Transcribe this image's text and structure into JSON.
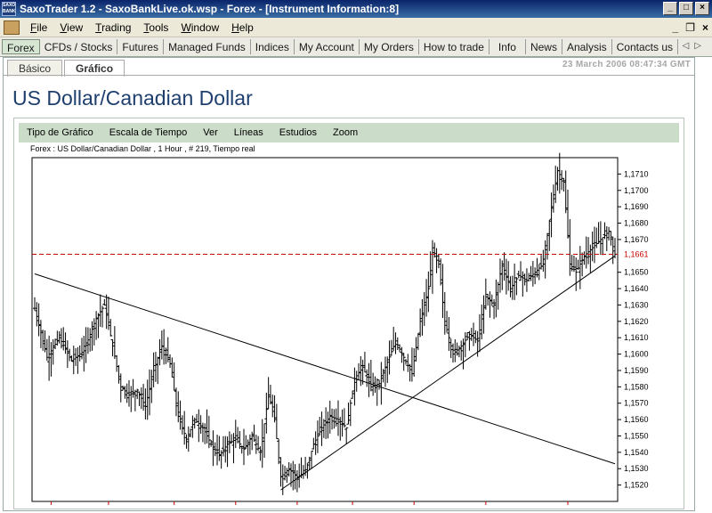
{
  "window": {
    "title": "SaxoTrader 1.2 - SaxoBankLive.ok.wsp - Forex - [Instrument Information:8]",
    "logo_text": "SAXO BANK"
  },
  "menu": [
    "File",
    "View",
    "Trading",
    "Tools",
    "Window",
    "Help"
  ],
  "nav_tabs": [
    "Forex",
    "CFDs / Stocks",
    "Futures",
    "Managed Funds",
    "Indices",
    "My Account",
    "My Orders",
    "How to trade",
    "Info",
    "News",
    "Analysis",
    "Contacts us"
  ],
  "sub_tabs": [
    "Básico",
    "Gráfico"
  ],
  "timestamp": "23 March 2006 08:47:34 GMT",
  "page_title": "US Dollar/Canadian Dollar",
  "chart_toolbar": [
    "Tipo de Gráfico",
    "Escala de Tiempo",
    "Ver",
    "Líneas",
    "Estudios",
    "Zoom"
  ],
  "chart_info": "Forex : US Dollar/Canadian Dollar , 1 Hour , # 219, Tiempo real",
  "chart_data": {
    "type": "ohlc",
    "ylim": [
      1.151,
      1.172
    ],
    "y_ticks": [
      "1,1710",
      "1,1700",
      "1,1690",
      "1,1680",
      "1,1670",
      "1,1650",
      "1,1640",
      "1,1630",
      "1,1620",
      "1,1610",
      "1,1600",
      "1,1590",
      "1,1580",
      "1,1570",
      "1,1560",
      "1,1550",
      "1,1540",
      "1,1530",
      "1,1520"
    ],
    "y_tick_values": [
      1.171,
      1.17,
      1.169,
      1.168,
      1.167,
      1.165,
      1.164,
      1.163,
      1.162,
      1.161,
      1.16,
      1.159,
      1.158,
      1.157,
      1.156,
      1.155,
      1.154,
      1.153,
      1.152
    ],
    "current_price": "1,1661",
    "current_price_value": 1.1661,
    "colors": {
      "bars": "#000000",
      "current_line": "#cc0000",
      "current_label": "#cc0000"
    },
    "anchor_closes": [
      [
        0,
        1.1628
      ],
      [
        6,
        1.1598
      ],
      [
        12,
        1.161
      ],
      [
        18,
        1.1596
      ],
      [
        24,
        1.1602
      ],
      [
        30,
        1.1622
      ],
      [
        34,
        1.163
      ],
      [
        38,
        1.1605
      ],
      [
        42,
        1.158
      ],
      [
        46,
        1.1575
      ],
      [
        50,
        1.1578
      ],
      [
        54,
        1.1568
      ],
      [
        58,
        1.159
      ],
      [
        62,
        1.1605
      ],
      [
        66,
        1.1594
      ],
      [
        70,
        1.1562
      ],
      [
        74,
        1.1548
      ],
      [
        78,
        1.156
      ],
      [
        82,
        1.1555
      ],
      [
        86,
        1.1545
      ],
      [
        90,
        1.1538
      ],
      [
        94,
        1.1545
      ],
      [
        98,
        1.1548
      ],
      [
        102,
        1.1542
      ],
      [
        106,
        1.155
      ],
      [
        110,
        1.154
      ],
      [
        114,
        1.1575
      ],
      [
        117,
        1.156
      ],
      [
        120,
        1.1525
      ],
      [
        124,
        1.153
      ],
      [
        128,
        1.1525
      ],
      [
        132,
        1.1528
      ],
      [
        136,
        1.1545
      ],
      [
        140,
        1.1555
      ],
      [
        144,
        1.1562
      ],
      [
        148,
        1.156
      ],
      [
        152,
        1.1555
      ],
      [
        156,
        1.1585
      ],
      [
        160,
        1.1592
      ],
      [
        164,
        1.158
      ],
      [
        168,
        1.1582
      ],
      [
        172,
        1.1595
      ],
      [
        176,
        1.1608
      ],
      [
        180,
        1.1598
      ],
      [
        184,
        1.1588
      ],
      [
        188,
        1.162
      ],
      [
        192,
        1.164
      ],
      [
        194,
        1.1662
      ],
      [
        197,
        1.1655
      ],
      [
        200,
        1.162
      ],
      [
        204,
        1.16
      ],
      [
        208,
        1.1605
      ],
      [
        212,
        1.1612
      ],
      [
        216,
        1.1608
      ],
      [
        220,
        1.1635
      ],
      [
        224,
        1.163
      ],
      [
        228,
        1.1655
      ],
      [
        232,
        1.164
      ],
      [
        236,
        1.1648
      ],
      [
        240,
        1.1645
      ],
      [
        244,
        1.165
      ],
      [
        248,
        1.1655
      ],
      [
        252,
        1.169
      ],
      [
        255,
        1.1712
      ],
      [
        258,
        1.1705
      ],
      [
        261,
        1.1655
      ],
      [
        264,
        1.165
      ],
      [
        268,
        1.166
      ],
      [
        272,
        1.1665
      ],
      [
        276,
        1.167
      ],
      [
        280,
        1.1675
      ],
      [
        283,
        1.1661
      ]
    ],
    "trendlines": [
      {
        "x1": 0,
        "y1": 1.1649,
        "x2": 283,
        "y2": 1.1533
      },
      {
        "x1": 120,
        "y1": 1.1517,
        "x2": 283,
        "y2": 1.166
      }
    ],
    "vertical_ticks": [
      8,
      36,
      68,
      98,
      128,
      155,
      185,
      220,
      260
    ]
  }
}
